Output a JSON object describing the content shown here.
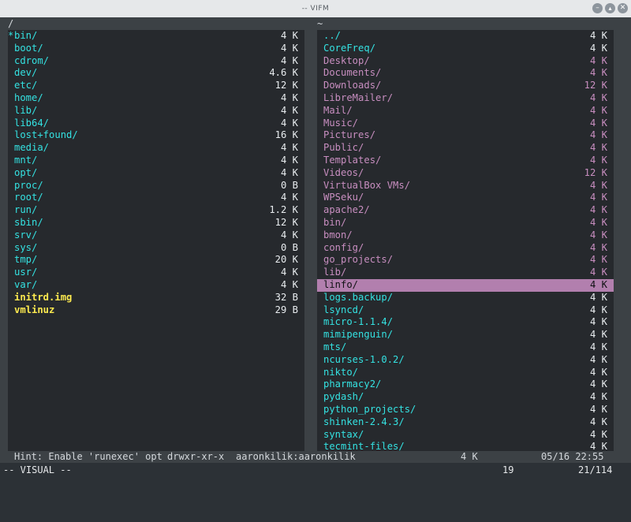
{
  "window": {
    "title": "-- VIFM"
  },
  "left_pane": {
    "path": "/",
    "entries": [
      {
        "mark": "*",
        "name": "bin/",
        "size": "4 K",
        "kind": "sel"
      },
      {
        "mark": "",
        "name": "boot/",
        "size": "4 K",
        "kind": "dir"
      },
      {
        "mark": "",
        "name": "cdrom/",
        "size": "4 K",
        "kind": "dir"
      },
      {
        "mark": "",
        "name": "dev/",
        "size": "4.6 K",
        "kind": "dir"
      },
      {
        "mark": "",
        "name": "etc/",
        "size": "12 K",
        "kind": "dir"
      },
      {
        "mark": "",
        "name": "home/",
        "size": "4 K",
        "kind": "dir"
      },
      {
        "mark": "",
        "name": "lib/",
        "size": "4 K",
        "kind": "dir"
      },
      {
        "mark": "",
        "name": "lib64/",
        "size": "4 K",
        "kind": "dir"
      },
      {
        "mark": "",
        "name": "lost+found/",
        "size": "16 K",
        "kind": "dir"
      },
      {
        "mark": "",
        "name": "media/",
        "size": "4 K",
        "kind": "dir"
      },
      {
        "mark": "",
        "name": "mnt/",
        "size": "4 K",
        "kind": "dir"
      },
      {
        "mark": "",
        "name": "opt/",
        "size": "4 K",
        "kind": "dir"
      },
      {
        "mark": "",
        "name": "proc/",
        "size": "0 B",
        "kind": "dir"
      },
      {
        "mark": "",
        "name": "root/",
        "size": "4 K",
        "kind": "dir"
      },
      {
        "mark": "",
        "name": "run/",
        "size": "1.2 K",
        "kind": "dir"
      },
      {
        "mark": "",
        "name": "sbin/",
        "size": "12 K",
        "kind": "dir"
      },
      {
        "mark": "",
        "name": "srv/",
        "size": "4 K",
        "kind": "dir"
      },
      {
        "mark": "",
        "name": "sys/",
        "size": "0 B",
        "kind": "dir"
      },
      {
        "mark": "",
        "name": "tmp/",
        "size": "20 K",
        "kind": "dir"
      },
      {
        "mark": "",
        "name": "usr/",
        "size": "4 K",
        "kind": "dir"
      },
      {
        "mark": "",
        "name": "var/",
        "size": "4 K",
        "kind": "dir"
      },
      {
        "mark": "",
        "name": "initrd.img",
        "size": "32 B",
        "kind": "exe"
      },
      {
        "mark": "",
        "name": "vmlinuz",
        "size": "29 B",
        "kind": "exe"
      }
    ]
  },
  "right_pane": {
    "path": "~",
    "entries": [
      {
        "name": "../",
        "size": "4 K",
        "kind": "dir"
      },
      {
        "name": "CoreFreq/",
        "size": "4 K",
        "kind": "dir"
      },
      {
        "name": "Desktop/",
        "size": "4 K",
        "kind": "sym"
      },
      {
        "name": "Documents/",
        "size": "4 K",
        "kind": "sym"
      },
      {
        "name": "Downloads/",
        "size": "12 K",
        "kind": "sym"
      },
      {
        "name": "LibreMailer/",
        "size": "4 K",
        "kind": "sym"
      },
      {
        "name": "Mail/",
        "size": "4 K",
        "kind": "sym"
      },
      {
        "name": "Music/",
        "size": "4 K",
        "kind": "sym"
      },
      {
        "name": "Pictures/",
        "size": "4 K",
        "kind": "sym"
      },
      {
        "name": "Public/",
        "size": "4 K",
        "kind": "sym"
      },
      {
        "name": "Templates/",
        "size": "4 K",
        "kind": "sym"
      },
      {
        "name": "Videos/",
        "size": "12 K",
        "kind": "sym"
      },
      {
        "name": "VirtualBox VMs/",
        "size": "4 K",
        "kind": "sym"
      },
      {
        "name": "WPSeku/",
        "size": "4 K",
        "kind": "sym"
      },
      {
        "name": "apache2/",
        "size": "4 K",
        "kind": "sym"
      },
      {
        "name": "bin/",
        "size": "4 K",
        "kind": "sym"
      },
      {
        "name": "bmon/",
        "size": "4 K",
        "kind": "sym"
      },
      {
        "name": "config/",
        "size": "4 K",
        "kind": "sym"
      },
      {
        "name": "go_projects/",
        "size": "4 K",
        "kind": "sym"
      },
      {
        "name": "lib/",
        "size": "4 K",
        "kind": "sym"
      },
      {
        "name": "linfo/",
        "size": "4 K",
        "kind": "hl"
      },
      {
        "name": "logs.backup/",
        "size": "4 K",
        "kind": "dir"
      },
      {
        "name": "lsyncd/",
        "size": "4 K",
        "kind": "dir"
      },
      {
        "name": "micro-1.1.4/",
        "size": "4 K",
        "kind": "dir"
      },
      {
        "name": "mimipenguin/",
        "size": "4 K",
        "kind": "dir"
      },
      {
        "name": "mts/",
        "size": "4 K",
        "kind": "dir"
      },
      {
        "name": "ncurses-1.0.2/",
        "size": "4 K",
        "kind": "dir"
      },
      {
        "name": "nikto/",
        "size": "4 K",
        "kind": "dir"
      },
      {
        "name": "pharmacy2/",
        "size": "4 K",
        "kind": "dir"
      },
      {
        "name": "pydash/",
        "size": "4 K",
        "kind": "dir"
      },
      {
        "name": "python_projects/",
        "size": "4 K",
        "kind": "dir"
      },
      {
        "name": "shinken-2.4.3/",
        "size": "4 K",
        "kind": "dir"
      },
      {
        "name": "syntax/",
        "size": "4 K",
        "kind": "dir"
      },
      {
        "name": "tecmint-files/",
        "size": "4 K",
        "kind": "dir"
      }
    ]
  },
  "status_bar": {
    "hint": "Hint: Enable 'runexec' opt",
    "perms": "drwxr-xr-x",
    "owner": "aaronkilik:aaronkilik",
    "size": "4 K",
    "datetime": "05/16 22:55"
  },
  "command_line": {
    "mode": "-- VISUAL --",
    "selected_count": "19",
    "position": "21/114"
  },
  "colors": {
    "directory": "#34e2e2",
    "symlink": "#c88ec0",
    "executable": "#fce94f",
    "cursor_highlight": "#b27fae",
    "pane_background": "#26292d"
  }
}
